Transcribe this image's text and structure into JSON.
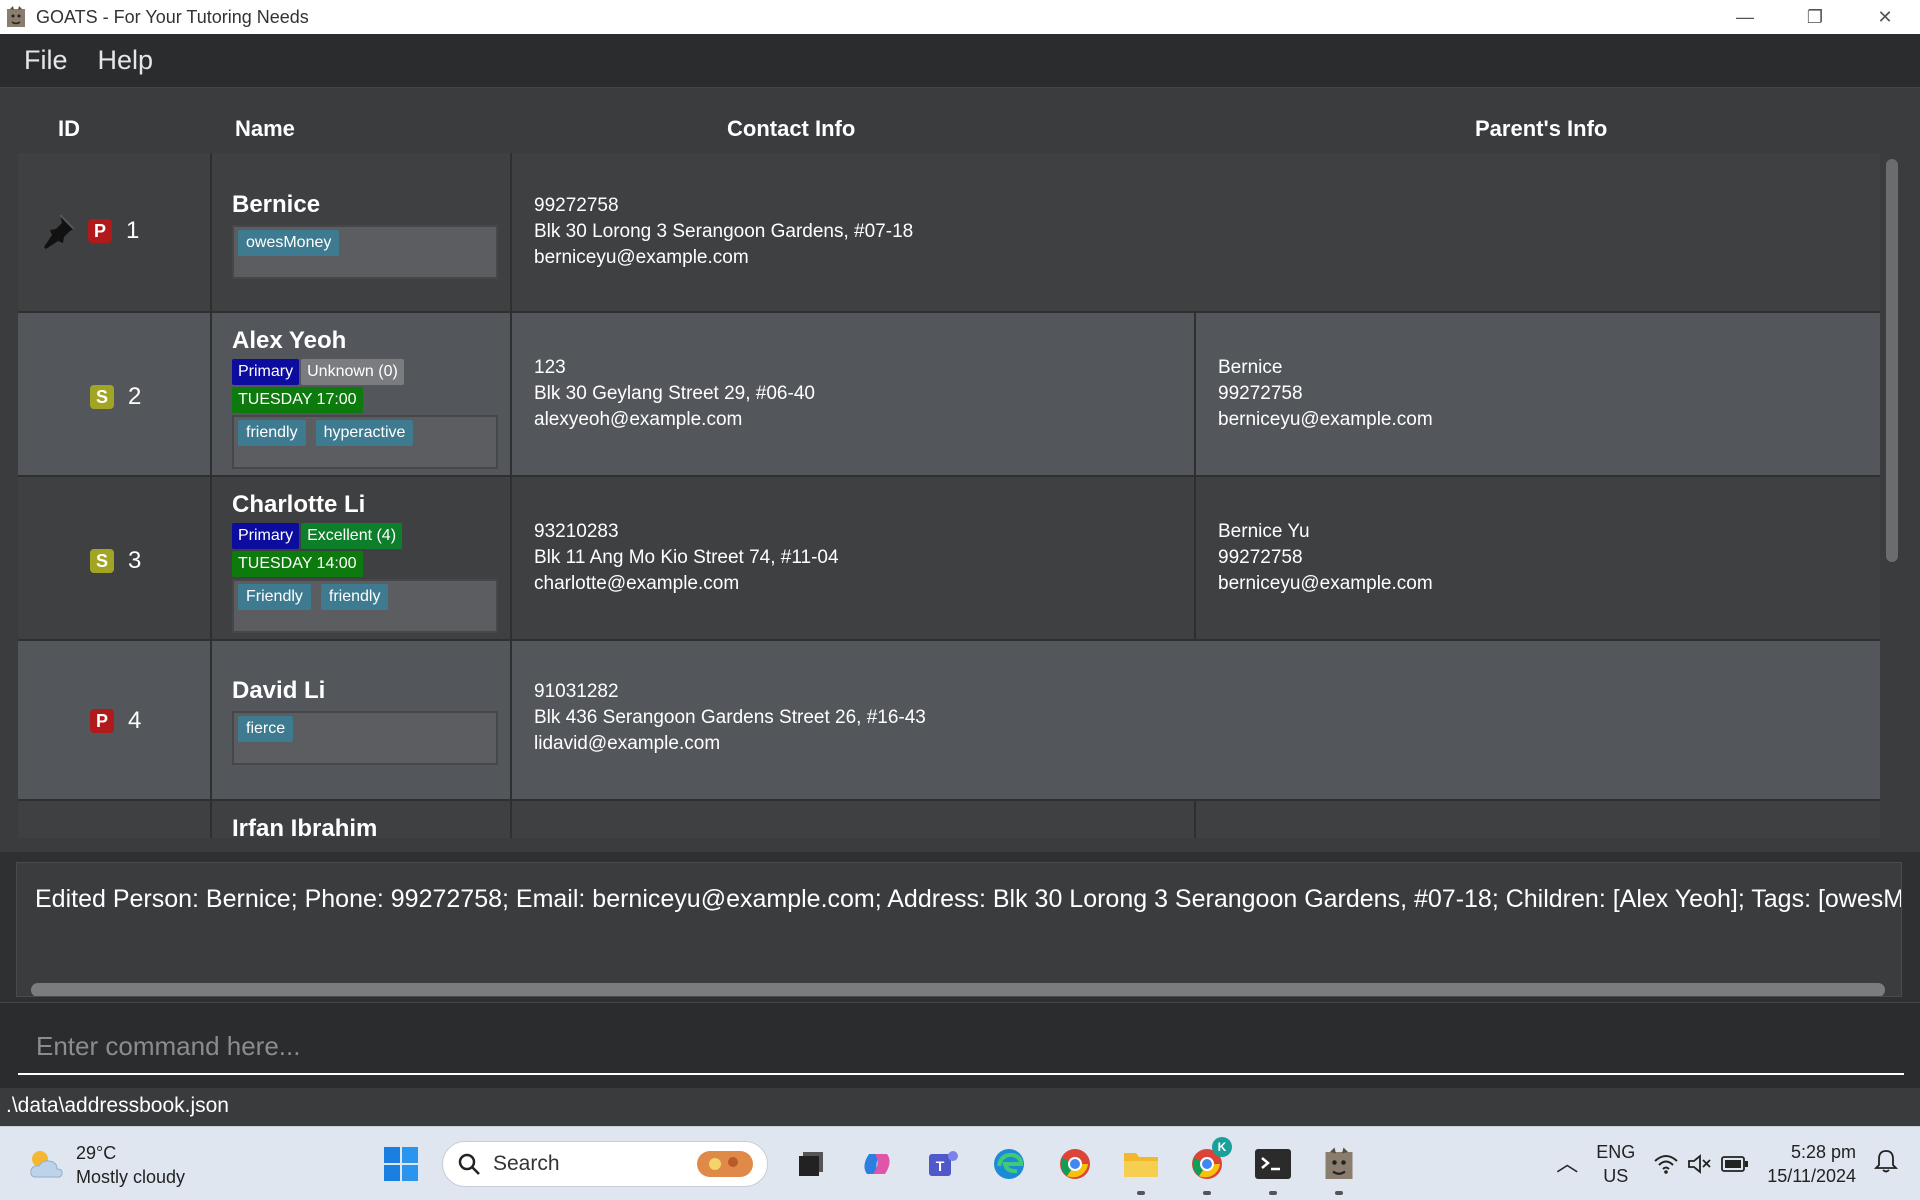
{
  "window": {
    "title": "GOATS - For Your Tutoring Needs",
    "minimize": "—",
    "restore": "❐",
    "close": "✕"
  },
  "menu": {
    "items": [
      "File",
      "Help"
    ]
  },
  "columns": {
    "id": "ID",
    "name": "Name",
    "contact": "Contact Info",
    "parent": "Parent's Info"
  },
  "persons": [
    {
      "id": "1",
      "type": "P",
      "pinned": true,
      "name": "Bernice",
      "tags": [
        "owesMoney"
      ],
      "contact": [
        "99272758",
        "Blk 30 Lorong 3 Serangoon Gardens, #07-18",
        "berniceyu@example.com"
      ],
      "parent": []
    },
    {
      "id": "2",
      "type": "S",
      "pinned": false,
      "name": "Alex Yeoh",
      "level": "Primary",
      "grade": "Unknown (0)",
      "lesson": "TUESDAY 17:00",
      "tags": [
        "friendly",
        "hyperactive"
      ],
      "contact": [
        "123",
        "Blk 30 Geylang Street 29, #06-40",
        "alexyeoh@example.com"
      ],
      "parent": [
        "Bernice",
        "99272758",
        "berniceyu@example.com"
      ]
    },
    {
      "id": "3",
      "type": "S",
      "pinned": false,
      "name": "Charlotte Li",
      "level": "Primary",
      "grade": "Excellent (4)",
      "lesson": "TUESDAY 14:00",
      "tags": [
        "Friendly",
        "friendly"
      ],
      "contact": [
        "93210283",
        "Blk 11 Ang Mo Kio Street 74, #11-04",
        "charlotte@example.com"
      ],
      "parent": [
        "Bernice Yu",
        "99272758",
        "berniceyu@example.com"
      ]
    },
    {
      "id": "4",
      "type": "P",
      "pinned": false,
      "name": "David  Li",
      "tags": [
        "fierce"
      ],
      "contact": [
        "91031282",
        "Blk 436 Serangoon Gardens Street 26, #16-43",
        "lidavid@example.com"
      ],
      "parent": []
    },
    {
      "id": "",
      "type": "",
      "pinned": false,
      "name": "Irfan Ibrahim",
      "tags": [],
      "contact": [],
      "parent": []
    }
  ],
  "result": {
    "text": "Edited Person: Bernice; Phone: 99272758; Email: berniceyu@example.com; Address: Blk 30 Lorong 3 Serangoon Gardens, #07-18; Children: [Alex Yeoh]; Tags: [owesMoney]"
  },
  "command": {
    "placeholder": "Enter command here..."
  },
  "status": {
    "path": ".\\data\\addressbook.json"
  },
  "taskbar": {
    "weather_temp": "29°C",
    "weather_desc": "Mostly cloudy",
    "search_label": "Search",
    "lang_top": "ENG",
    "lang_bottom": "US",
    "time": "5:28 pm",
    "date": "15/11/2024",
    "chrome_badge": "K"
  },
  "colors": {
    "level": "#0c0c9e",
    "grade_unknown": "#7a7c80",
    "grade_excellent": "#0d7f2a",
    "lesson": "#0c7a0c",
    "tag": "#3e7b91",
    "parent_badge": "#b01a1a",
    "student_badge": "#a2a524"
  }
}
